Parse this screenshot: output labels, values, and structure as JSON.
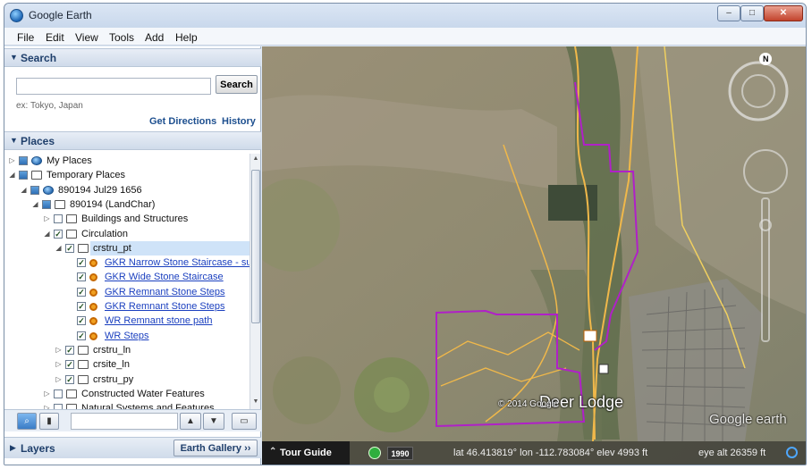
{
  "window": {
    "title": "Google Earth",
    "min_label": "–",
    "max_label": "□",
    "close_label": "✕"
  },
  "menu": [
    "File",
    "Edit",
    "View",
    "Tools",
    "Add",
    "Help"
  ],
  "search": {
    "header": "Search",
    "input_value": "",
    "placeholder": "",
    "button": "Search",
    "hint": "ex: Tokyo, Japan",
    "get_directions": "Get Directions",
    "history": "History"
  },
  "places": {
    "header": "Places",
    "items": [
      {
        "label": "My Places",
        "indent": 0,
        "expander": "▷",
        "check": "part",
        "icon": "globe",
        "link": false,
        "selected": false
      },
      {
        "label": "Temporary Places",
        "indent": 0,
        "expander": "◢",
        "check": "part",
        "icon": "folder-open",
        "link": false,
        "selected": false
      },
      {
        "label": "890194 Jul29 1656",
        "indent": 1,
        "expander": "◢",
        "check": "part",
        "icon": "globe",
        "link": false,
        "selected": false
      },
      {
        "label": "890194 (LandChar)",
        "indent": 2,
        "expander": "◢",
        "check": "part",
        "icon": "folder-open",
        "link": false,
        "selected": false
      },
      {
        "label": "Buildings and Structures",
        "indent": 3,
        "expander": "▷",
        "check": "off",
        "icon": "folder",
        "link": false,
        "selected": false
      },
      {
        "label": "Circulation",
        "indent": 3,
        "expander": "◢",
        "check": "on",
        "icon": "folder-open",
        "link": false,
        "selected": false
      },
      {
        "label": "crstru_pt",
        "indent": 4,
        "expander": "◢",
        "check": "on",
        "icon": "folder-open",
        "link": false,
        "selected": true
      },
      {
        "label": "GKR Narrow Stone Staircase - su",
        "indent": 5,
        "expander": "",
        "check": "on",
        "icon": "pin",
        "link": true,
        "selected": false
      },
      {
        "label": "GKR Wide Stone Staircase",
        "indent": 5,
        "expander": "",
        "check": "on",
        "icon": "pin",
        "link": true,
        "selected": false
      },
      {
        "label": "GKR Remnant Stone Steps",
        "indent": 5,
        "expander": "",
        "check": "on",
        "icon": "pin",
        "link": true,
        "selected": false
      },
      {
        "label": "GKR Remnant Stone Steps",
        "indent": 5,
        "expander": "",
        "check": "on",
        "icon": "pin",
        "link": true,
        "selected": false
      },
      {
        "label": "WR Remnant stone path",
        "indent": 5,
        "expander": "",
        "check": "on",
        "icon": "pin",
        "link": true,
        "selected": false
      },
      {
        "label": "WR Steps",
        "indent": 5,
        "expander": "",
        "check": "on",
        "icon": "pin",
        "link": true,
        "selected": false
      },
      {
        "label": "crstru_ln",
        "indent": 4,
        "expander": "▷",
        "check": "on",
        "icon": "folder",
        "link": false,
        "selected": false
      },
      {
        "label": "crsite_ln",
        "indent": 4,
        "expander": "▷",
        "check": "on",
        "icon": "folder",
        "link": false,
        "selected": false
      },
      {
        "label": "crstru_py",
        "indent": 4,
        "expander": "▷",
        "check": "on",
        "icon": "folder",
        "link": false,
        "selected": false
      },
      {
        "label": "Constructed Water Features",
        "indent": 3,
        "expander": "▷",
        "check": "off",
        "icon": "folder",
        "link": false,
        "selected": false
      },
      {
        "label": "Natural Systems and Features",
        "indent": 3,
        "expander": "▷",
        "check": "off",
        "icon": "folder",
        "link": false,
        "selected": false
      }
    ]
  },
  "tools": {
    "up": "▲",
    "down": "▼",
    "folder": "▭"
  },
  "layers": {
    "header": "Layers",
    "gallery": "Earth Gallery ››"
  },
  "map": {
    "compass_label": "N",
    "place_label": "Deer Lodge",
    "copyright": "© 2014 Google",
    "watermark": "Google earth",
    "tour_guide": "Tour Guide",
    "year": "1990",
    "coords": "lat  46.413819°  lon -112.783084°  elev  4993 ft",
    "eye_alt": "eye alt  26359 ft"
  }
}
